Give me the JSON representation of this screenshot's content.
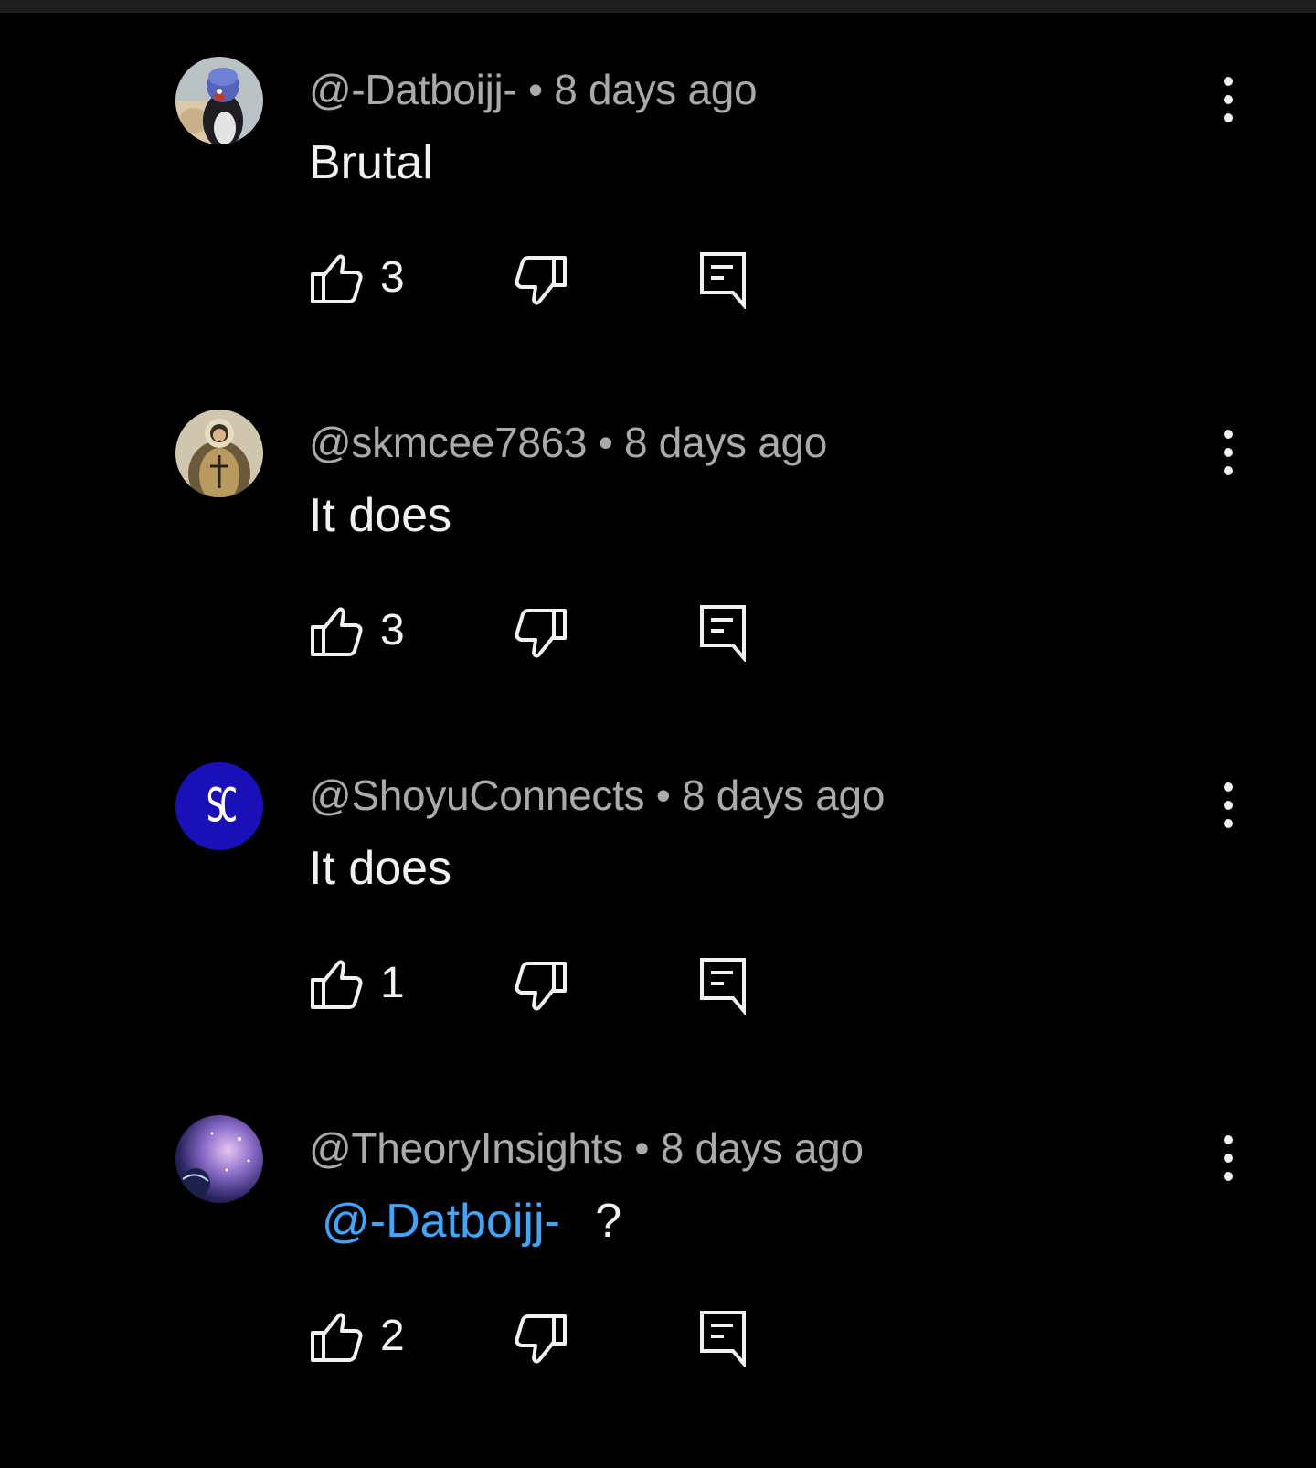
{
  "comments": [
    {
      "author": "@-Datboijj-",
      "separator": "•",
      "time": "8 days ago",
      "text": "Brutal",
      "mention": "",
      "likes": "3",
      "avatar_icon": "penguin-avatar"
    },
    {
      "author": "@skmcee7863",
      "separator": "•",
      "time": "8 days ago",
      "text": "It does",
      "mention": "",
      "likes": "3",
      "avatar_icon": "painting-avatar"
    },
    {
      "author": "@ShoyuConnects",
      "separator": "•",
      "time": "8 days ago",
      "text": "It does",
      "mention": "",
      "likes": "1",
      "avatar_icon": "sc-logo-avatar",
      "avatar_text": "SC"
    },
    {
      "author": "@TheoryInsights",
      "separator": "•",
      "time": "8 days ago",
      "text": "?",
      "mention": "@-Datboijj-",
      "likes": "2",
      "avatar_icon": "galaxy-avatar"
    }
  ],
  "icons": {
    "like": "thumbs-up-icon",
    "dislike": "thumbs-down-icon",
    "reply": "reply-comment-icon",
    "more": "more-vertical-icon"
  },
  "colors": {
    "background": "#000000",
    "meta_text": "#aaaaaa",
    "primary_text": "#f1f1f1",
    "mention": "#3ea6ff",
    "sc_avatar_bg": "#1a10b8"
  }
}
